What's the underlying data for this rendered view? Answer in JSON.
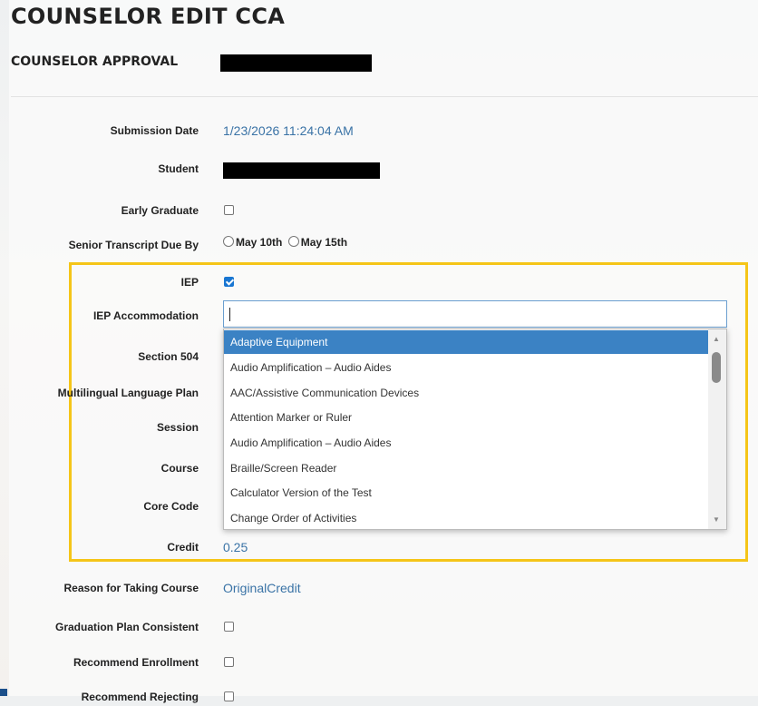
{
  "page": {
    "title": "COUNSELOR EDIT CCA",
    "subtitle": "COUNSELOR APPROVAL"
  },
  "form": {
    "submission_date_label": "Submission Date",
    "submission_date_value": "1/23/2026 11:24:04 AM",
    "student_label": "Student",
    "early_graduate_label": "Early Graduate",
    "early_graduate_checked": false,
    "senior_transcript_label": "Senior Transcript Due By",
    "senior_transcript_options": [
      "May 10th",
      "May 15th"
    ],
    "iep_label": "IEP",
    "iep_checked": true,
    "iep_accommodation_label": "IEP Accommodation",
    "iep_accommodation_value": "",
    "section504_label": "Section 504",
    "multilingual_label": "Multilingual Language Plan",
    "session_label": "Session",
    "course_label": "Course",
    "core_code_label": "Core Code",
    "credit_label": "Credit",
    "credit_value": "0.25",
    "reason_label": "Reason for Taking Course",
    "reason_value": "OriginalCredit",
    "grad_plan_label": "Graduation Plan Consistent",
    "recommend_enrollment_label": "Recommend Enrollment",
    "recommend_rejecting_label": "Recommend Rejecting"
  },
  "dropdown": {
    "options": [
      "Adaptive Equipment",
      "Audio Amplification – Audio Aides",
      "AAC/Assistive Communication Devices",
      "Attention Marker or Ruler",
      "Audio Amplification – Audio Aides",
      "Braille/Screen Reader",
      "Calculator Version of the Test",
      "Change Order of Activities"
    ],
    "selected_index": 0
  },
  "colors": {
    "link_value": "#3a73a6",
    "highlight_border": "#f5c518",
    "selected_option": "#3b82c4",
    "checkbox_checked": "#1976d2"
  }
}
